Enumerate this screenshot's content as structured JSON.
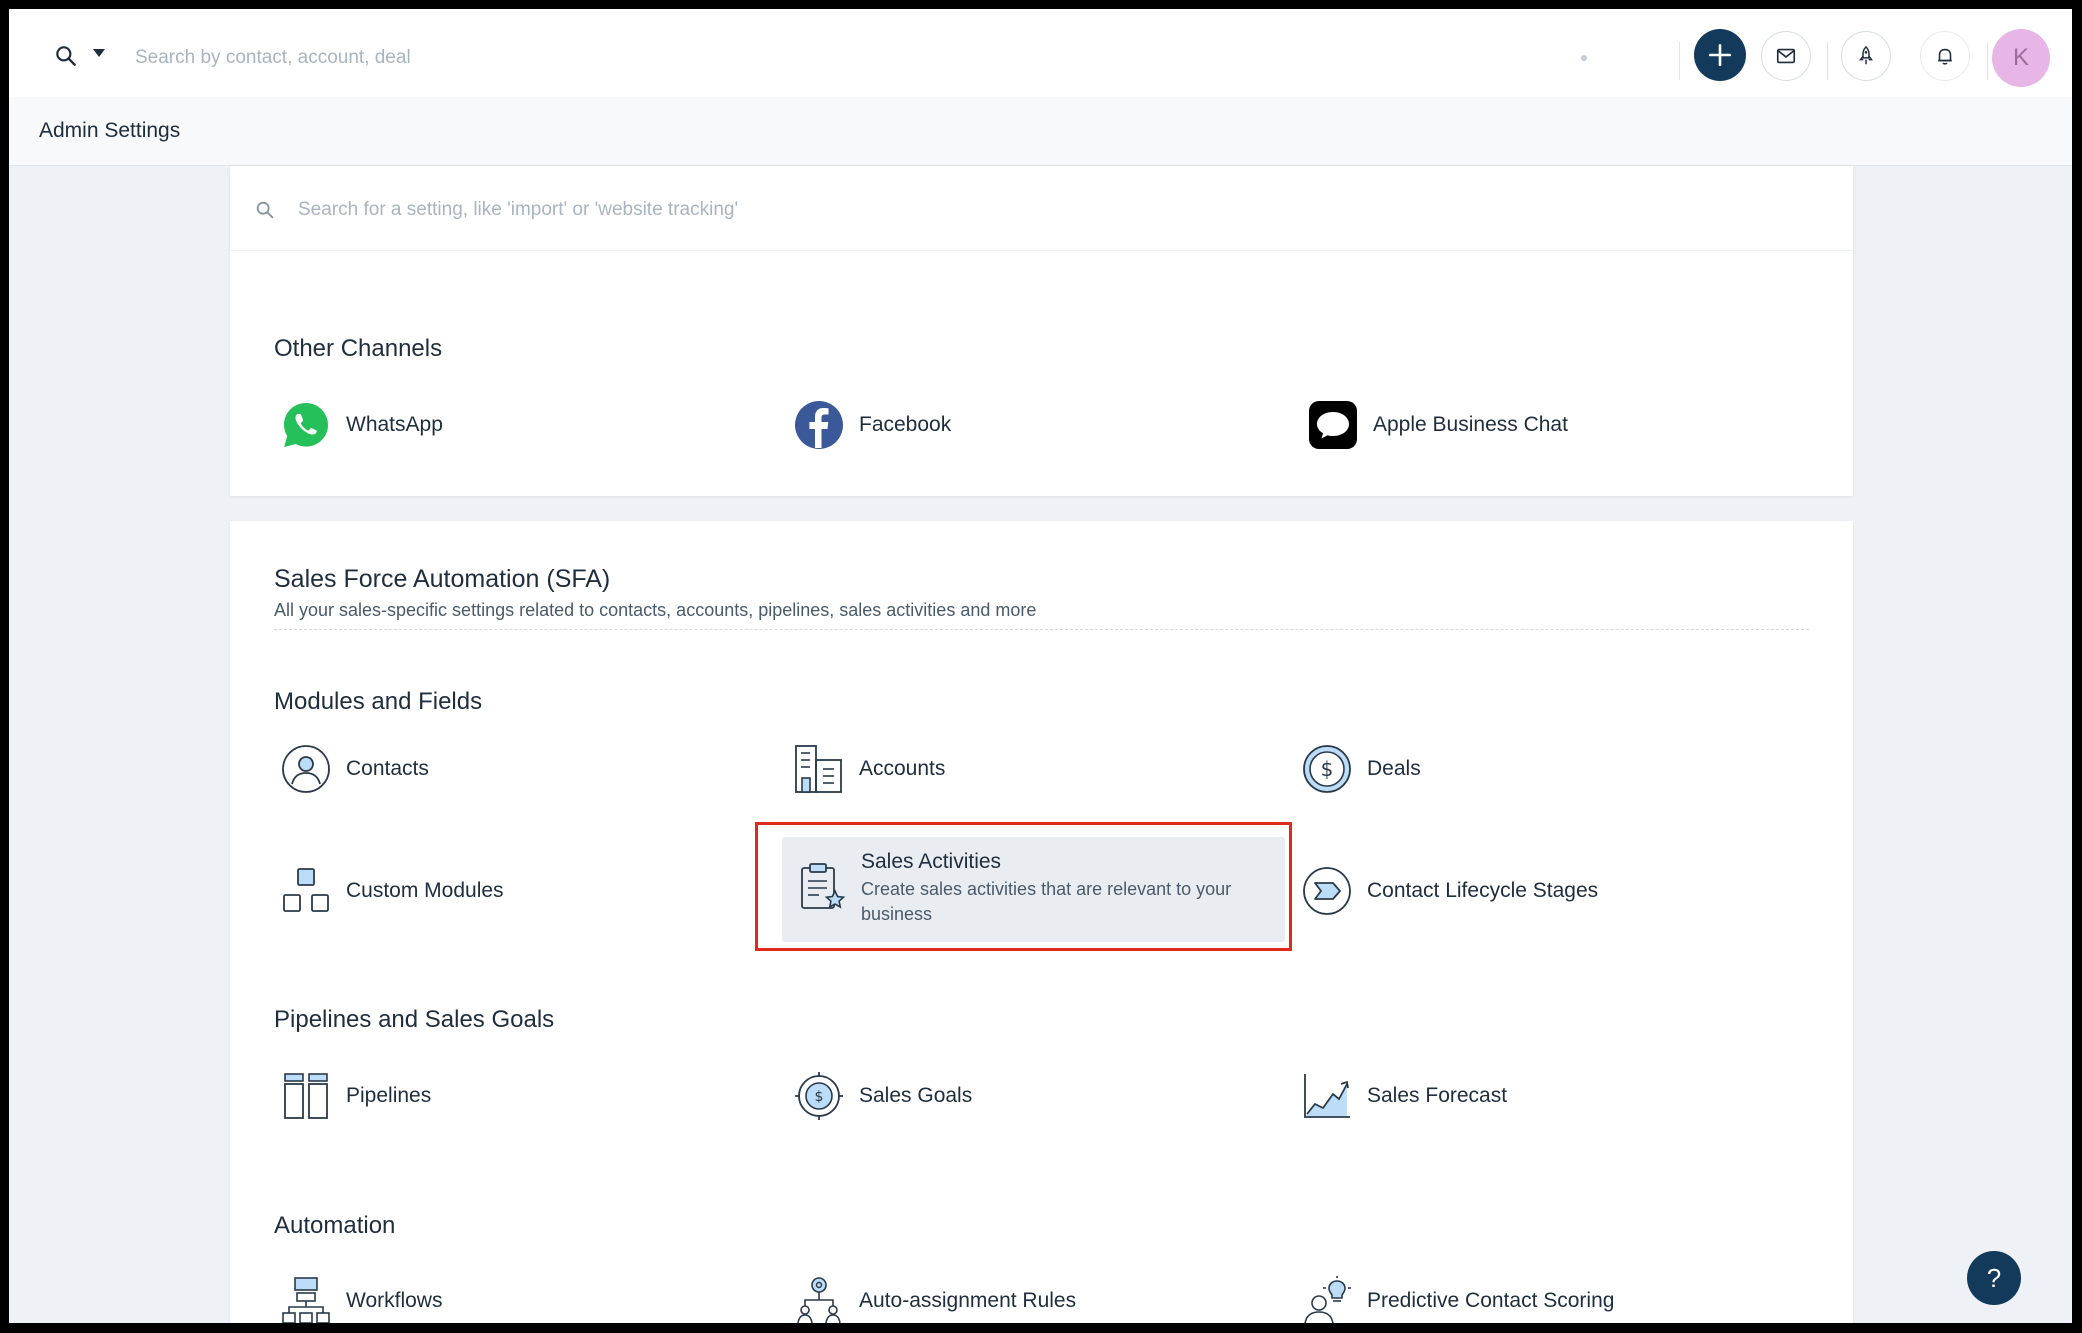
{
  "topbar": {
    "search_placeholder": "Search by contact, account, deal",
    "avatar_initial": "K"
  },
  "header": {
    "title": "Admin Settings"
  },
  "settings_search": {
    "placeholder": "Search for a setting, like 'import' or 'website tracking'"
  },
  "other_channels": {
    "title": "Other Channels",
    "items": [
      {
        "label": "WhatsApp",
        "icon": "whatsapp-icon"
      },
      {
        "label": "Facebook",
        "icon": "facebook-icon"
      },
      {
        "label": "Apple Business Chat",
        "icon": "apple-business-chat-icon"
      }
    ]
  },
  "sfa": {
    "title": "Sales Force Automation (SFA)",
    "subtitle": "All your sales-specific settings related to contacts, accounts, pipelines, sales activities and more",
    "modules": {
      "title": "Modules and Fields",
      "items": [
        {
          "label": "Contacts"
        },
        {
          "label": "Accounts"
        },
        {
          "label": "Deals"
        },
        {
          "label": "Custom Modules"
        },
        {
          "label": "Sales Activities",
          "description": "Create sales activities that are relevant to your business"
        },
        {
          "label": "Contact Lifecycle Stages"
        }
      ]
    },
    "pipelines": {
      "title": "Pipelines and Sales Goals",
      "items": [
        {
          "label": "Pipelines"
        },
        {
          "label": "Sales Goals"
        },
        {
          "label": "Sales Forecast"
        }
      ]
    },
    "automation": {
      "title": "Automation",
      "items": [
        {
          "label": "Workflows"
        },
        {
          "label": "Auto-assignment Rules"
        },
        {
          "label": "Predictive Contact Scoring"
        }
      ]
    }
  },
  "help": {
    "label": "?"
  },
  "colors": {
    "accent": "#133a5a",
    "highlight": "#e02b1c",
    "whatsapp": "#25c05a",
    "facebook": "#3b5998"
  }
}
